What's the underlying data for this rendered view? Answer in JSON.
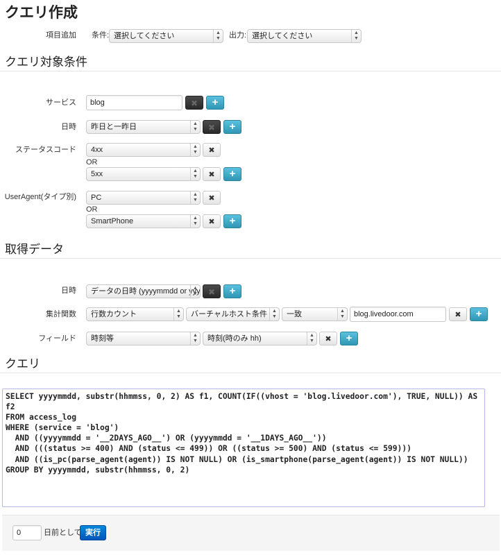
{
  "page": {
    "title": "クエリ作成"
  },
  "toolbar": {
    "add_item_label": "項目追加",
    "condition_label": "条件:",
    "condition_value": "選択してください",
    "output_label": "出力:",
    "output_value": "選択してください"
  },
  "conditions_section": {
    "title": "クエリ対象条件",
    "service": {
      "label": "サービス",
      "value": "blog"
    },
    "datetime": {
      "label": "日時",
      "value": "昨日と一昨日"
    },
    "status": {
      "label": "ステータスコード",
      "values": [
        "4xx",
        "5xx"
      ],
      "or_label": "OR"
    },
    "useragent": {
      "label": "UserAgent(タイプ別)",
      "values": [
        "PC",
        "SmartPhone"
      ],
      "or_label": "OR"
    }
  },
  "data_section": {
    "title": "取得データ",
    "datetime": {
      "label": "日時",
      "value": "データの日時 (yyyymmdd or yyy"
    },
    "aggregate": {
      "label": "集計関数",
      "func": "行数カウント",
      "cond": "バーチャルホスト条件",
      "match": "一致",
      "value": "blog.livedoor.com"
    },
    "field": {
      "label": "フィールド",
      "type": "時刻等",
      "value": "時刻(時のみ hh)"
    }
  },
  "query_section": {
    "title": "クエリ",
    "text": "SELECT yyyymmdd, substr(hhmmss, 0, 2) AS f1, COUNT(IF((vhost = 'blog.livedoor.com'), TRUE, NULL)) AS f2\nFROM access_log\nWHERE (service = 'blog')\n  AND ((yyyymmdd = '__2DAYS_AGO__') OR (yyyymmdd = '__1DAYS_AGO__'))\n  AND (((status >= 400) AND (status <= 499)) OR ((status >= 500) AND (status <= 599)))\n  AND ((is_pc(parse_agent(agent)) IS NOT NULL) OR (is_smartphone(parse_agent(agent)) IS NOT NULL))\nGROUP BY yyyymmdd, substr(hhmmss, 0, 2)"
  },
  "footer": {
    "days_value": "0",
    "days_suffix": "日前として",
    "run_label": "実行"
  },
  "icons": {
    "remove": "✖",
    "add": "+",
    "select_arrow": "▲▼"
  },
  "colors": {
    "add_button": "#49afcd",
    "run_button": "#006dcc",
    "remove_disabled": "#333333"
  }
}
